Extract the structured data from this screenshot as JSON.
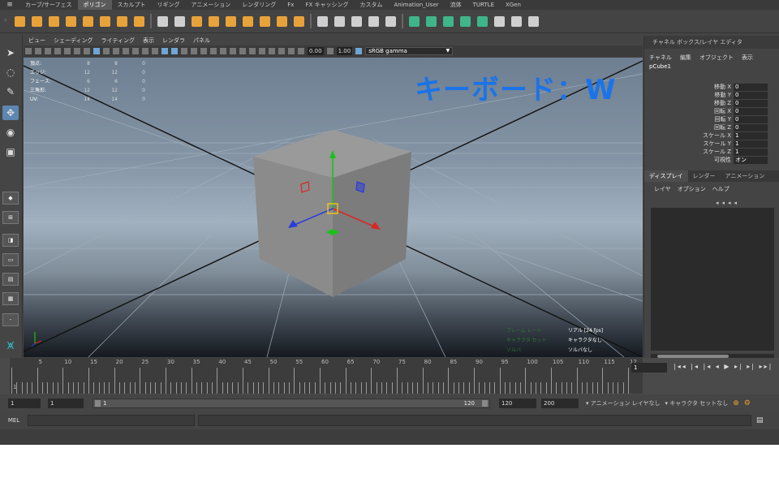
{
  "menu_tabs": [
    "カーブ/サーフェス",
    "ポリゴン",
    "スカルプト",
    "リギング",
    "アニメーション",
    "レンダリング",
    "Fx",
    "FX キャッシング",
    "カスタム",
    "Animation_User",
    "流体",
    "TURTLE",
    "XGen"
  ],
  "active_tab": "ポリゴン",
  "shelf_colors": [
    "#e8a23a",
    "#e8a23a",
    "#e8a23a",
    "#e8a23a",
    "#e8a23a",
    "#e8a23a",
    "#e8a23a",
    "#e8a23a",
    "#cfcfcf",
    "#cfcfcf",
    "#e8a23a",
    "#e8a23a",
    "#e8a23a",
    "#e8a23a",
    "#e8a23a",
    "#e8a23a",
    "#e8a23a",
    "#cfcfcf",
    "#cfcfcf",
    "#cfcfcf",
    "#cfcfcf",
    "#cfcfcf",
    "#3fb58a",
    "#3fb58a",
    "#3fb58a",
    "#3fb58a",
    "#3fb58a",
    "#cfcfcf",
    "#cfcfcf",
    "#cfcfcf"
  ],
  "panel_menu": [
    "ビュー",
    "シェーディング",
    "ライティング",
    "表示",
    "レンダラ",
    "パネル"
  ],
  "panel_toolbar": {
    "value1": "0.00",
    "value2": "1.00",
    "color_space": "sRGB gamma"
  },
  "hud_stats": [
    {
      "label": "頂点:",
      "a": "8",
      "b": "8",
      "c": "0"
    },
    {
      "label": "エッジ:",
      "a": "12",
      "b": "12",
      "c": "0"
    },
    {
      "label": "フェース:",
      "a": "6",
      "b": "6",
      "c": "0"
    },
    {
      "label": "三角形:",
      "a": "12",
      "b": "12",
      "c": "0"
    },
    {
      "label": "UV:",
      "a": "14",
      "b": "14",
      "c": "0"
    }
  ],
  "viewport_caption": "キーボード：W",
  "hud_bottom": [
    {
      "key": "フレーム レート",
      "value": "リアル [24 fps]"
    },
    {
      "key": "キャラクタ セット",
      "value": "キャラクタなし"
    },
    {
      "key": "ソルバ",
      "value": "ソルバなし"
    }
  ],
  "channel_box": {
    "title": "チャネル ボックス/レイヤ エディタ",
    "menu": [
      "チャネル",
      "編集",
      "オブジェクト",
      "表示"
    ],
    "object": "pCube1",
    "attributes": [
      {
        "name": "移動 X",
        "value": "0"
      },
      {
        "name": "移動 Y",
        "value": "0"
      },
      {
        "name": "移動 Z",
        "value": "0"
      },
      {
        "name": "回転 X",
        "value": "0"
      },
      {
        "name": "回転 Y",
        "value": "0"
      },
      {
        "name": "回転 Z",
        "value": "0"
      },
      {
        "name": "スケール X",
        "value": "1"
      },
      {
        "name": "スケール Y",
        "value": "1"
      },
      {
        "name": "スケール Z",
        "value": "1"
      },
      {
        "name": "可視性",
        "value": "オン"
      }
    ]
  },
  "layer_editor": {
    "tabs": [
      "ディスプレイ",
      "レンダー",
      "アニメーション"
    ],
    "menu": [
      "レイヤ",
      "オプション",
      "ヘルプ"
    ]
  },
  "timeline": {
    "ticks": [
      "5",
      "10",
      "15",
      "20",
      "25",
      "30",
      "35",
      "40",
      "45",
      "50",
      "55",
      "60",
      "65",
      "70",
      "75",
      "80",
      "85",
      "90",
      "95",
      "100",
      "105",
      "110",
      "115",
      "12"
    ],
    "current_frame": "1",
    "left_frame": "1"
  },
  "range": {
    "start": "1",
    "playback_start": "1",
    "slider_start": "1",
    "slider_end": "120",
    "playback_end": "120",
    "end": "200",
    "anim_layer": "アニメーション レイヤなし",
    "char_set": "キャラクタ セットなし"
  },
  "command_line": {
    "label": "MEL"
  }
}
